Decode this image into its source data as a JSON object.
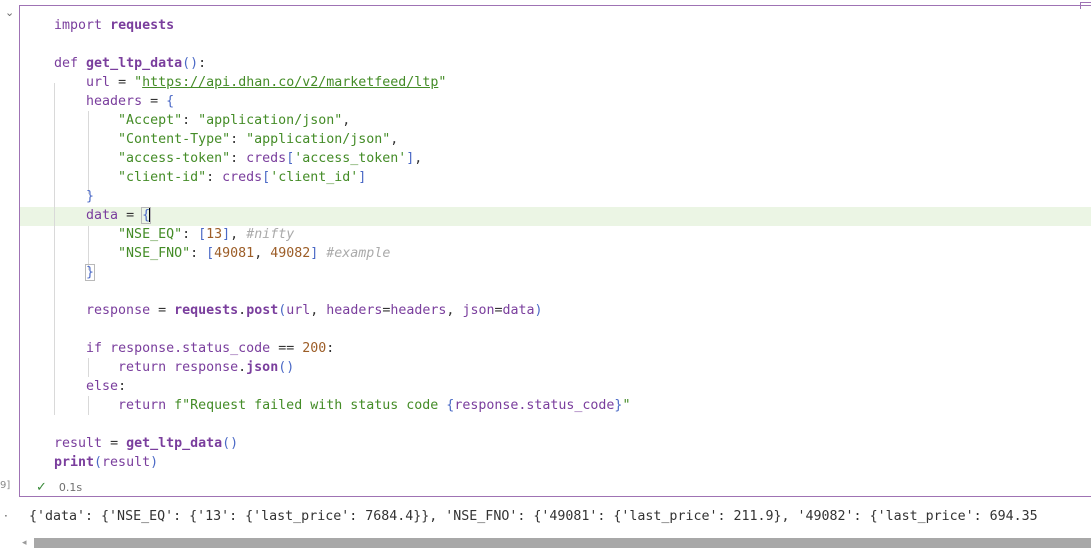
{
  "cell": {
    "execution_count": "9]",
    "status_time": "0.1s",
    "status_icon": "checkmark-icon"
  },
  "code": {
    "import_kw": "import",
    "import_mod": "requests",
    "def_kw": "def",
    "func_name": "get_ltp_data",
    "url_var": "url",
    "url_value": "https://api.dhan.co/v2/marketfeed/ltp",
    "headers_var": "headers",
    "header_accept_key": "\"Accept\"",
    "header_accept_val": "\"application/json\"",
    "header_ctype_key": "\"Content-Type\"",
    "header_ctype_val": "\"application/json\"",
    "header_token_key": "\"access-token\"",
    "header_token_src": "creds",
    "header_token_val": "'access_token'",
    "header_client_key": "\"client-id\"",
    "header_client_src": "creds",
    "header_client_val": "'client_id'",
    "data_var": "data",
    "nse_eq_key": "\"NSE_EQ\"",
    "nse_eq_val": "13",
    "nse_eq_comment": "#nifty",
    "nse_fno_key": "\"NSE_FNO\"",
    "nse_fno_val1": "49081",
    "nse_fno_val2": "49082",
    "nse_fno_comment": "#example",
    "response_var": "response",
    "post_mod": "requests",
    "post_fn": "post",
    "post_args_url": "url",
    "post_args_headers_kw": "headers",
    "post_args_headers_val": "headers",
    "post_args_json_kw": "json",
    "post_args_json_val": "data",
    "if_kw": "if",
    "status_attr": "response.status_code",
    "status_op": "==",
    "status_val": "200",
    "return_kw": "return",
    "json_obj": "response",
    "json_fn": "json",
    "else_kw": "else",
    "fail_prefix": "f\"Request failed with status code ",
    "fail_expr": "response.status_code",
    "fail_suffix": "\"",
    "result_var": "result",
    "call_fn": "get_ltp_data",
    "print_fn": "print",
    "print_arg": "result"
  },
  "output": {
    "text": "{'data': {'NSE_EQ': {'13': {'last_price': 7684.4}}, 'NSE_FNO': {'49081': {'last_price': 211.9}, '49082': {'last_price': 694.35"
  }
}
